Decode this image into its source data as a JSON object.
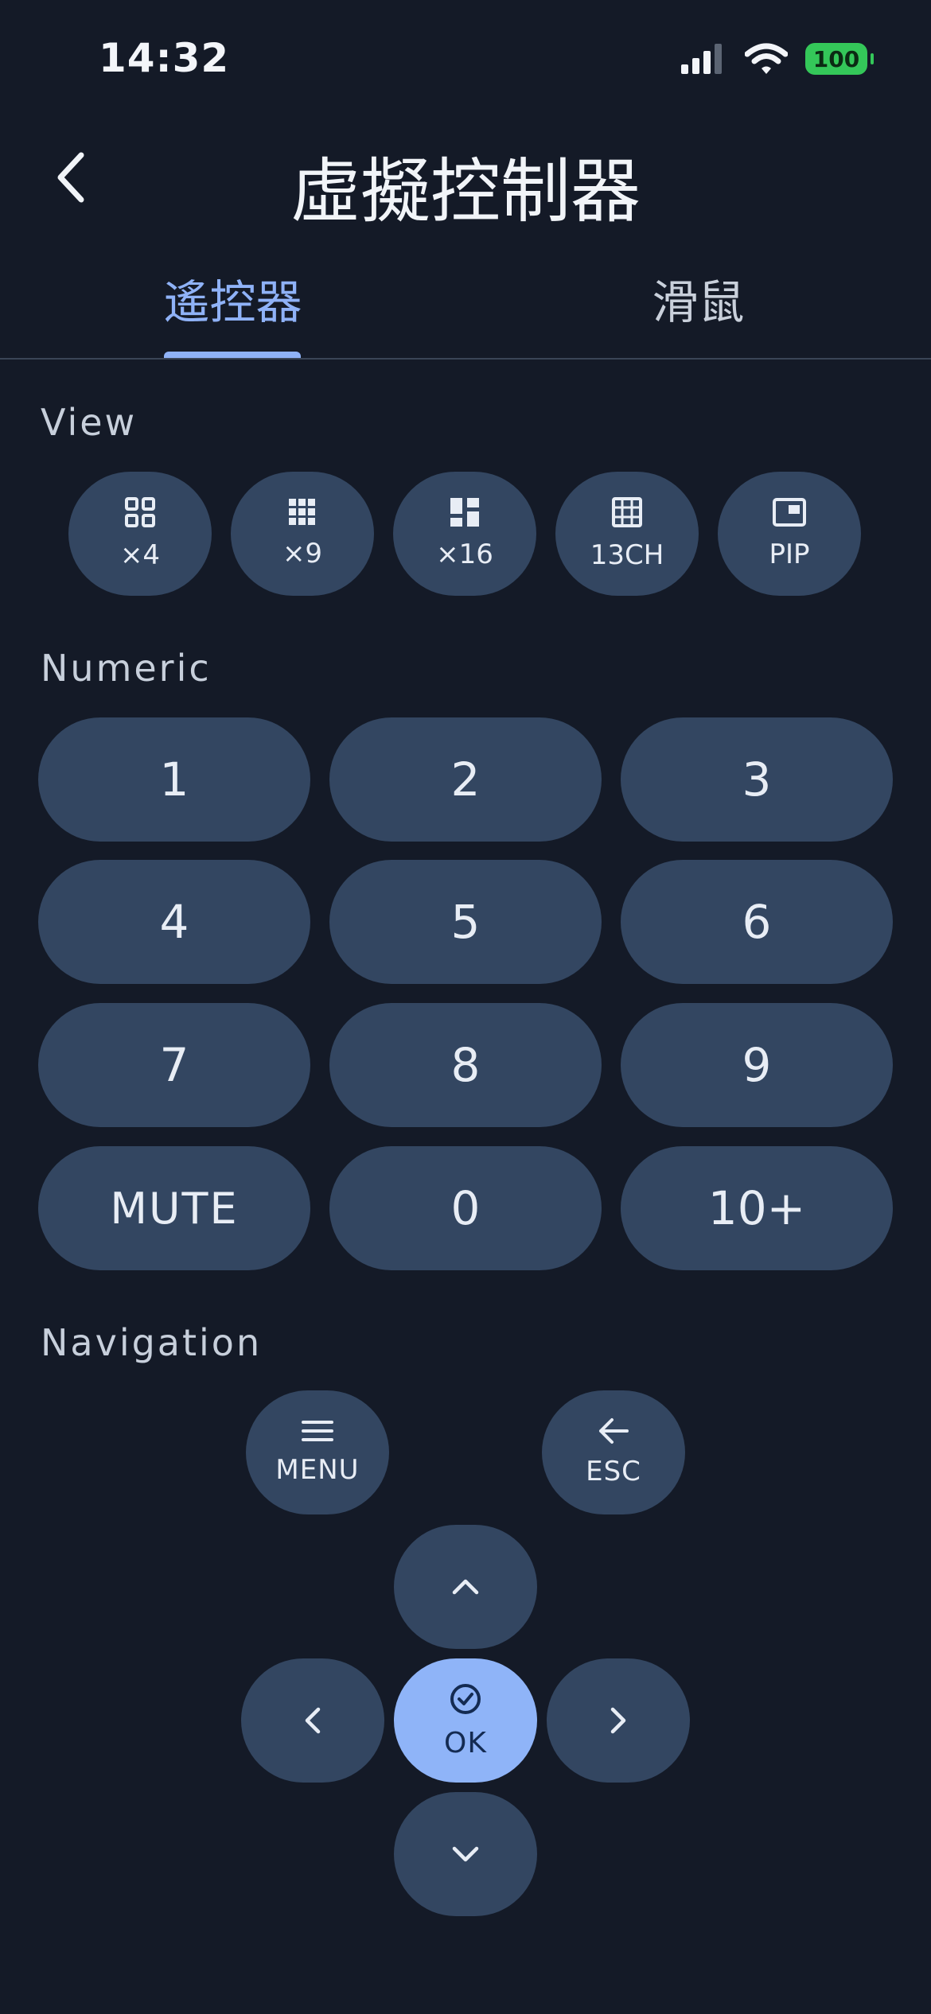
{
  "status_bar": {
    "time": "14:32",
    "battery": "100"
  },
  "header": {
    "title": "虛擬控制器"
  },
  "tabs": [
    {
      "label": "遙控器",
      "active": true
    },
    {
      "label": "滑鼠",
      "active": false
    }
  ],
  "view": {
    "label": "View",
    "buttons": [
      {
        "icon": "grid-2x2-icon",
        "label": "×4"
      },
      {
        "icon": "grid-3x3-dots-icon",
        "label": "×9"
      },
      {
        "icon": "dashboard-layout-icon",
        "label": "×16"
      },
      {
        "icon": "grid-table-icon",
        "label": "13CH"
      },
      {
        "icon": "picture-in-picture-icon",
        "label": "PIP"
      }
    ]
  },
  "numeric": {
    "label": "Numeric",
    "keys": [
      "1",
      "2",
      "3",
      "4",
      "5",
      "6",
      "7",
      "8",
      "9",
      "MUTE",
      "0",
      "10+"
    ]
  },
  "navigation": {
    "label": "Navigation",
    "menu": {
      "icon": "hamburger-menu-icon",
      "label": "MENU"
    },
    "esc": {
      "icon": "arrow-left-icon",
      "label": "ESC"
    },
    "ok": {
      "icon": "check-circle-icon",
      "label": "OK"
    }
  },
  "colors": {
    "background": "#141a27",
    "button": "#334661",
    "accent": "#8fb2f7"
  }
}
